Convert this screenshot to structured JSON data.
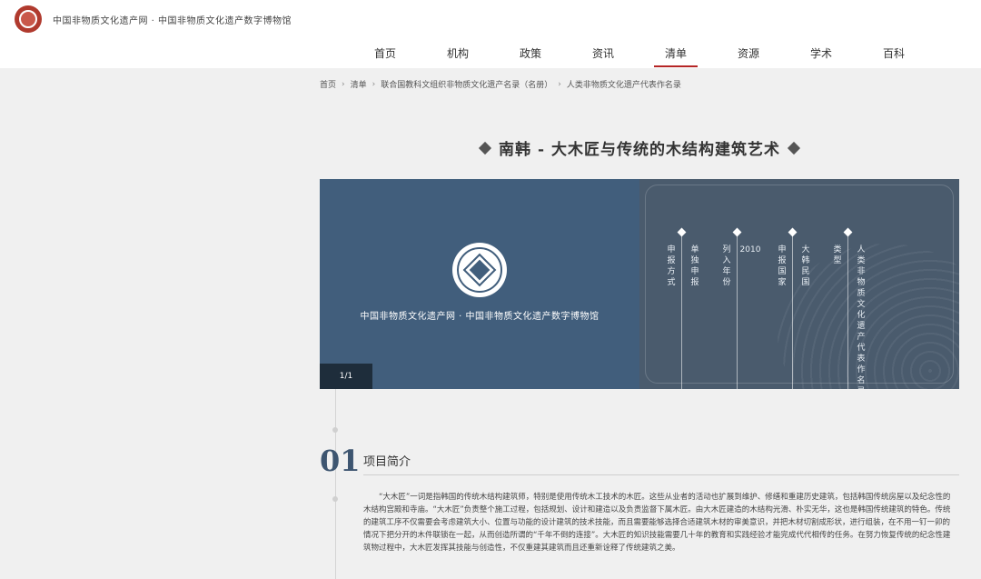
{
  "site": {
    "title": "中国非物质文化遗产网 · 中国非物质文化遗产数字博物馆"
  },
  "nav": {
    "items": [
      "首页",
      "机构",
      "政策",
      "资讯",
      "清单",
      "资源",
      "学术",
      "百科"
    ],
    "active_index": 4
  },
  "breadcrumb": [
    "首页",
    "清单",
    "联合国教科文组织非物质文化遗产名录（名册）",
    "人类非物质文化遗产代表作名录"
  ],
  "page_title": "南韩 - 大木匠与传统的木结构建筑艺术",
  "banner": {
    "caption": "中国非物质文化遗产网 · 中国非物质文化遗产数字博物馆",
    "pager": "1/1",
    "info": [
      {
        "label": "申报方式",
        "value": "单独申报"
      },
      {
        "label": "列入年份",
        "value": "2010"
      },
      {
        "label": "申报国家",
        "value": "大韩民国"
      },
      {
        "label": "类型",
        "value": "人类非物质文化遗产代表作名录"
      }
    ]
  },
  "section": {
    "number": "01",
    "title": "项目简介",
    "body": "“大木匠”一词是指韩国的传统木结构建筑师，特别是使用传统木工技术的木匠。这些从业者的活动也扩展到维护、修缮和重建历史建筑，包括韩国传统房屋以及纪念性的木结构宫殿和寺庙。“大木匠”负责整个施工过程，包括规划、设计和建造以及负责监督下属木匠。由大木匠建造的木结构光滑、朴实无华，这也是韩国传统建筑的特色。传统的建筑工序不仅需要会考虑建筑大小、位置与功能的设计建筑的技术技能，而且需要能够选择合适建筑木材的审美意识，并把木材切割成形状，进行组装，在不用一钉一卯的情况下把分开的木件联锁在一起，从而创造所谓的“千年不倒的连接”。大木匠的知识技能需要几十年的教育和实践经验才能完成代代相传的任务。在努力恢复传统的纪念性建筑物过程中，大木匠发挥其技能与创造性，不仅重建其建筑而且还重新诠释了传统建筑之美。"
  }
}
